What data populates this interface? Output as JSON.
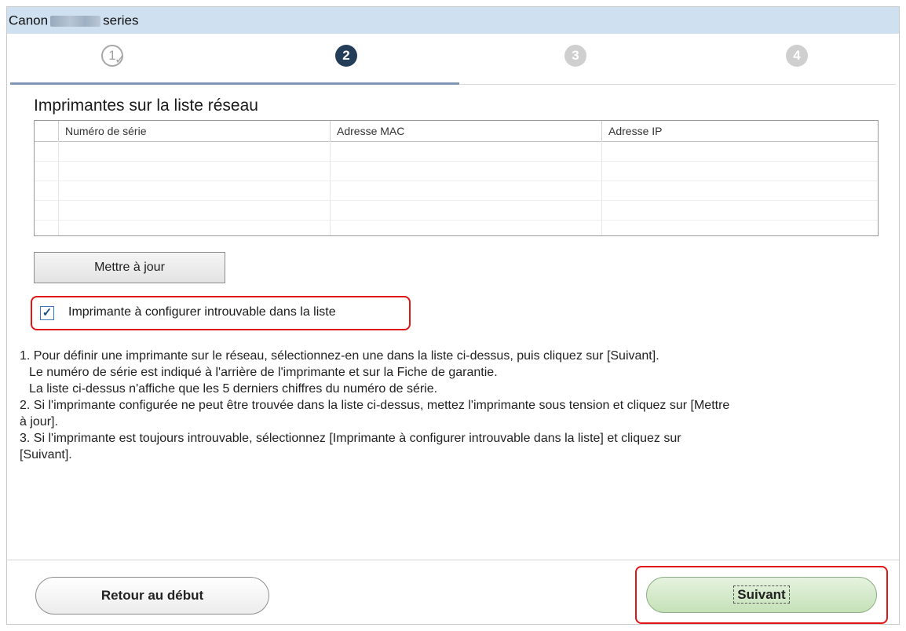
{
  "window": {
    "title_prefix": "Canon",
    "title_suffix": "series"
  },
  "steps": {
    "items": [
      "1",
      "2",
      "3",
      "4"
    ],
    "current": 2,
    "completed_icon": "checkmark-icon"
  },
  "printer_list": {
    "title": "Imprimantes sur la liste réseau",
    "columns": [
      "Numéro de série",
      "Adresse MAC",
      "Adresse IP"
    ],
    "rows": []
  },
  "buttons": {
    "update_label": "Mettre à jour",
    "back_label": "Retour au début",
    "next_label": "Suivant"
  },
  "not_found_option": {
    "label": "Imprimante à configurer introuvable dans la liste",
    "checked": true
  },
  "instructions": {
    "line1": "1. Pour définir une imprimante sur le réseau, sélectionnez-en une dans la liste ci-dessus, puis cliquez sur [Suivant].",
    "line2": "Le numéro de série est indiqué à l'arrière de l'imprimante et sur la Fiche de garantie.",
    "line3": "La liste ci-dessus n'affiche que les 5 derniers chiffres du numéro de série.",
    "line4": "2. Si l'imprimante configurée ne peut être trouvée dans la liste ci-dessus, mettez l'imprimante sous tension et cliquez sur [Mettre",
    "line5": "à jour].",
    "line6": "3. Si l'imprimante est toujours introuvable, sélectionnez [Imprimante à configurer introuvable dans la liste] et cliquez sur",
    "line7": "[Suivant]."
  },
  "colors": {
    "highlight_frame": "#e01515",
    "current_step": "#243e5a",
    "next_button": "#c5e1b8",
    "titlebar": "#cfe0f1"
  }
}
